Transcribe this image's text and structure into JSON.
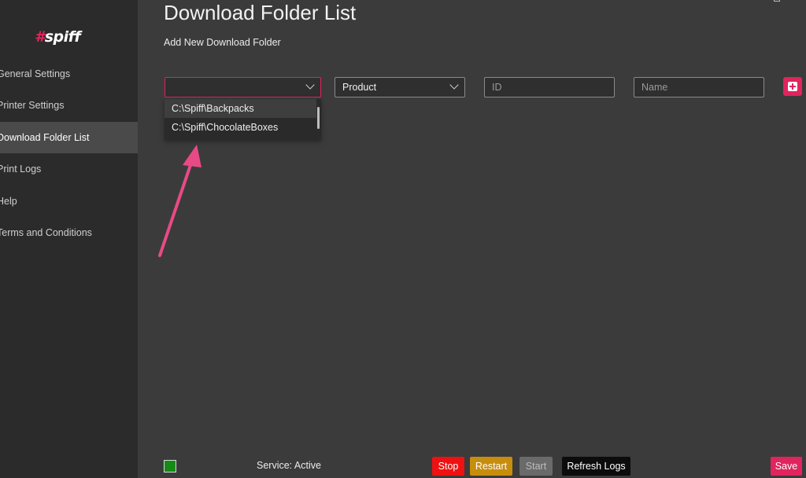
{
  "sidebar": {
    "logo": {
      "hash": "#",
      "text": "spiff"
    },
    "items": [
      {
        "label": "General Settings"
      },
      {
        "label": "Printer Settings"
      },
      {
        "label": "Download Folder List"
      },
      {
        "label": "Print Logs"
      },
      {
        "label": "Help"
      },
      {
        "label": "Terms and Conditions"
      }
    ]
  },
  "main": {
    "title": "Download Folder List",
    "subtitle": "Add New Download Folder",
    "form": {
      "folder_select": {
        "value": "",
        "options": [
          "C:\\Spiff\\Backpacks",
          "C:\\Spiff\\ChocolateBoxes"
        ]
      },
      "product_select": {
        "value": "Product"
      },
      "id_input": {
        "value": "",
        "placeholder": "ID"
      },
      "name_input": {
        "value": "",
        "placeholder": "Name"
      }
    }
  },
  "footer": {
    "service_status": "Service: Active",
    "status_color": "#168a16",
    "buttons": {
      "stop": "Stop",
      "restart": "Restart",
      "start": "Start",
      "refresh_logs": "Refresh Logs",
      "save": "Save"
    }
  },
  "colors": {
    "accent": "#e0245e",
    "background": "#3b3b3b",
    "sidebar": "#2b2b2b"
  },
  "icons": {
    "add_button": "plus-square-icon",
    "select_arrow": "chevron-down-icon",
    "annotation": "arrow-icon"
  }
}
